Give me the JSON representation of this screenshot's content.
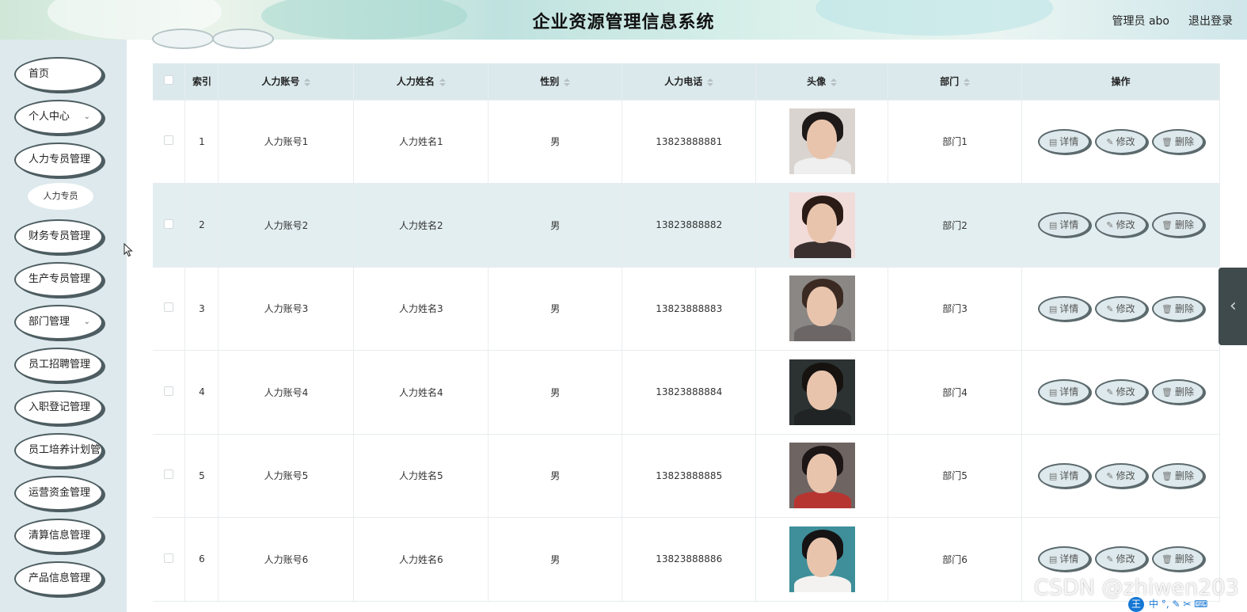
{
  "header": {
    "title": "企业资源管理信息系统",
    "user": "管理员 abo",
    "logout": "退出登录"
  },
  "sidebar": {
    "items": [
      {
        "label": "首页",
        "chevron": false
      },
      {
        "label": "个人中心",
        "chevron": true
      },
      {
        "label": "人力专员管理",
        "chevron": false
      },
      {
        "label": "财务专员管理",
        "chevron": false
      },
      {
        "label": "生产专员管理",
        "chevron": false
      },
      {
        "label": "部门管理",
        "chevron": true
      },
      {
        "label": "员工招聘管理",
        "chevron": false
      },
      {
        "label": "入职登记管理",
        "chevron": false
      },
      {
        "label": "员工培养计划管理",
        "chevron": false
      },
      {
        "label": "运营资金管理",
        "chevron": false
      },
      {
        "label": "清算信息管理",
        "chevron": false
      },
      {
        "label": "产品信息管理",
        "chevron": false
      }
    ],
    "submenu_item": "人力专员"
  },
  "table": {
    "headers": {
      "index": "索引",
      "account": "人力账号",
      "name": "人力姓名",
      "gender": "性别",
      "phone": "人力电话",
      "avatar": "头像",
      "dept": "部门",
      "actions": "操作"
    },
    "rows": [
      {
        "index": "1",
        "account": "人力账号1",
        "name": "人力姓名1",
        "gender": "男",
        "phone": "13823888881",
        "dept": "部门1"
      },
      {
        "index": "2",
        "account": "人力账号2",
        "name": "人力姓名2",
        "gender": "男",
        "phone": "13823888882",
        "dept": "部门2"
      },
      {
        "index": "3",
        "account": "人力账号3",
        "name": "人力姓名3",
        "gender": "男",
        "phone": "13823888883",
        "dept": "部门3"
      },
      {
        "index": "4",
        "account": "人力账号4",
        "name": "人力姓名4",
        "gender": "男",
        "phone": "13823888884",
        "dept": "部门4"
      },
      {
        "index": "5",
        "account": "人力账号5",
        "name": "人力姓名5",
        "gender": "男",
        "phone": "13823888885",
        "dept": "部门5"
      },
      {
        "index": "6",
        "account": "人力账号6",
        "name": "人力姓名6",
        "gender": "男",
        "phone": "13823888886",
        "dept": "部门6"
      }
    ],
    "actions": {
      "detail": "详情",
      "edit": "修改",
      "delete": "删除"
    }
  },
  "avatar_palettes": [
    {
      "bg": "#d9d4cf",
      "hair": "#1f1a1a",
      "shoulder": "#efefef"
    },
    {
      "bg": "#f1dcd9",
      "hair": "#2b1b16",
      "shoulder": "#3a3030"
    },
    {
      "bg": "#8a8784",
      "hair": "#3b2a22",
      "shoulder": "#6c6766"
    },
    {
      "bg": "#2c3232",
      "hair": "#15120f",
      "shoulder": "#202424"
    },
    {
      "bg": "#6e6462",
      "hair": "#1c1616",
      "shoulder": "#b63530"
    },
    {
      "bg": "#3e8f9a",
      "hair": "#161314",
      "shoulder": "#f3f2f0"
    }
  ],
  "watermark": "CSDN @zhiwen203",
  "ime_text": "中 °, ✎ ✂ ⌨"
}
